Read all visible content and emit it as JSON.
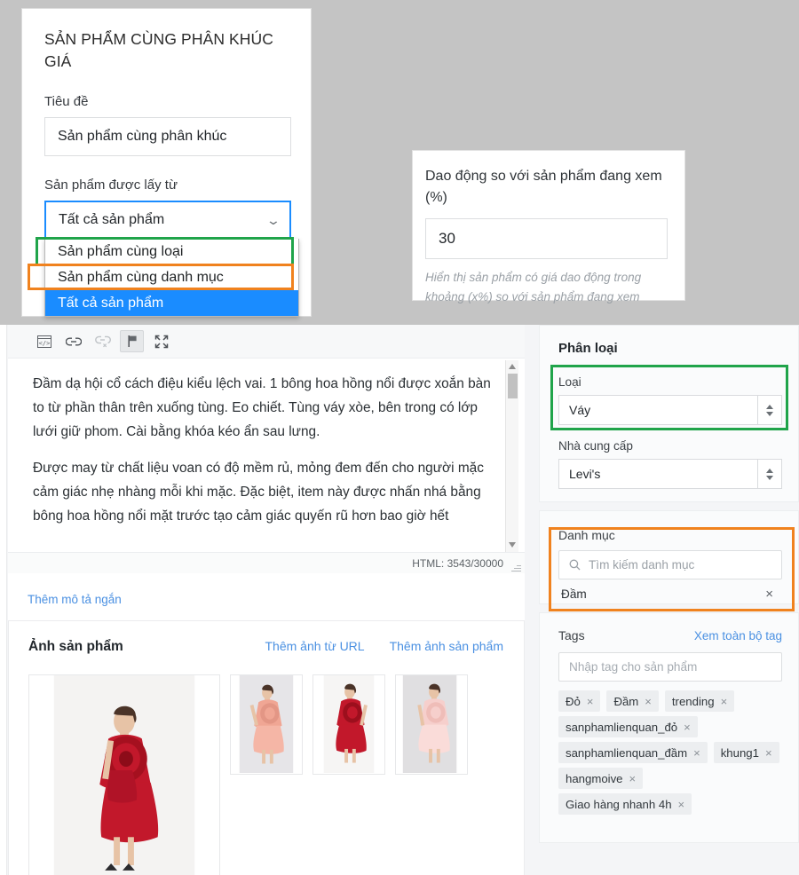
{
  "widget": {
    "title": "SẢN PHẨM CÙNG PHÂN KHÚC GIÁ",
    "label_title": "Tiêu đề",
    "title_value": "Sản phẩm cùng phân khúc",
    "label_source": "Sản phẩm được lấy từ",
    "source_value": "Tất cả sản phẩm",
    "chevron": "chevron-down-icon",
    "options": [
      {
        "label": "Sản phẩm cùng loại",
        "selected": false,
        "highlight": "green"
      },
      {
        "label": "Sản phẩm cùng danh mục",
        "selected": false,
        "highlight": "orange"
      },
      {
        "label": "Tất cả sản phẩm",
        "selected": true,
        "highlight": "none"
      }
    ]
  },
  "percent_card": {
    "label": "Dao động so với sản phẩm đang xem (%)",
    "value": "30",
    "help": "Hiển thị sản phẩm có giá dao động trong khoảng (x%) so với sản phẩm đang xem"
  },
  "editor": {
    "toolbar": [
      {
        "name": "source-code-icon",
        "glyph": "code",
        "active": false
      },
      {
        "name": "insert-link-icon",
        "glyph": "link",
        "active": false
      },
      {
        "name": "remove-link-icon",
        "glyph": "unlink",
        "active": false
      },
      {
        "name": "anchor-flag-icon",
        "glyph": "flag",
        "active": true
      },
      {
        "name": "fullscreen-icon",
        "glyph": "expand",
        "active": false
      }
    ],
    "paragraphs": [
      "Đầm dạ hội cổ cách điệu kiểu lệch vai. 1 bông hoa hồng nổi được xoắn bàn to từ phần thân trên xuống tùng. Eo chiết. Tùng váy xòe, bên trong có lớp lưới giữ phom. Cài bằng khóa kéo ẩn sau lưng.",
      "Được may từ chất liệu voan có độ mềm rủ, mỏng đem đến cho người mặc cảm giác nhẹ nhàng mỗi khi mặc. Đặc biệt, item này được nhấn nhá bằng bông hoa hồng nổi mặt trước tạo cảm giác quyến rũ hơn bao giờ hết"
    ],
    "status": "HTML: 3543/30000",
    "short_desc_link": "Thêm mô tả ngắn"
  },
  "images": {
    "title": "Ảnh sản phẩm",
    "add_from_url": "Thêm ảnh từ URL",
    "add_image": "Thêm ảnh sản phẩm",
    "thumbnails": [
      {
        "name": "product-image-main",
        "dress": "#c2182b",
        "bg": "#f3f2f1"
      },
      {
        "name": "product-image-2",
        "dress": "#f0a694",
        "bg": "#e7e6e9"
      },
      {
        "name": "product-image-3",
        "dress": "#c2182b",
        "bg": "#f6f5f4"
      },
      {
        "name": "product-image-4",
        "dress": "#f6cfcc",
        "bg": "#e2e1e3"
      }
    ]
  },
  "classification": {
    "panel_title": "Phân loại",
    "type_label": "Loại",
    "type_value": "Váy",
    "vendor_label": "Nhà cung cấp",
    "vendor_value": "Levi's"
  },
  "category": {
    "label": "Danh mục",
    "search_placeholder": "Tìm kiếm danh mục",
    "search_icon": "search-icon",
    "selected": [
      {
        "label": "Đầm",
        "remove": "×"
      }
    ]
  },
  "tags": {
    "label": "Tags",
    "view_all": "Xem toàn bộ tag",
    "input_placeholder": "Nhập tag cho sản phẩm",
    "items": [
      "Đỏ",
      "Đầm",
      "trending",
      "sanphamlienquan_đỏ",
      "sanphamlienquan_đầm",
      "khung1",
      "hangmoive",
      "Giao hàng nhanh 4h"
    ],
    "remove_glyph": "×"
  },
  "colors": {
    "highlight_green": "#20a44a",
    "highlight_orange": "#f0821e",
    "accent_blue": "#1a8cff",
    "link_blue": "#4a90e2",
    "overlay_grey": "#c4c4c4"
  }
}
